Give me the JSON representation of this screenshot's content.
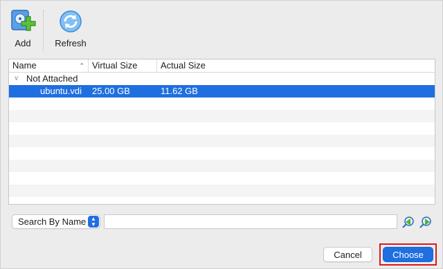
{
  "toolbar": {
    "add_label": "Add",
    "add_icon": "add-disk-icon",
    "refresh_label": "Refresh",
    "refresh_icon": "refresh-icon"
  },
  "table": {
    "columns": [
      "Name",
      "Virtual Size",
      "Actual Size"
    ],
    "sort_indicator": "⌃",
    "group": {
      "label": "Not Attached",
      "rows": [
        {
          "name": "ubuntu.vdi",
          "virtual_size": "25.00 GB",
          "actual_size": "11.62 GB",
          "selected": true
        }
      ]
    }
  },
  "search": {
    "mode_label": "Search By Name",
    "value": "",
    "prev_icon": "search-previous-icon",
    "next_icon": "search-next-icon"
  },
  "footer": {
    "cancel_label": "Cancel",
    "choose_label": "Choose"
  },
  "colors": {
    "accent": "#1f6fe0",
    "highlight_frame": "#e0151b"
  }
}
